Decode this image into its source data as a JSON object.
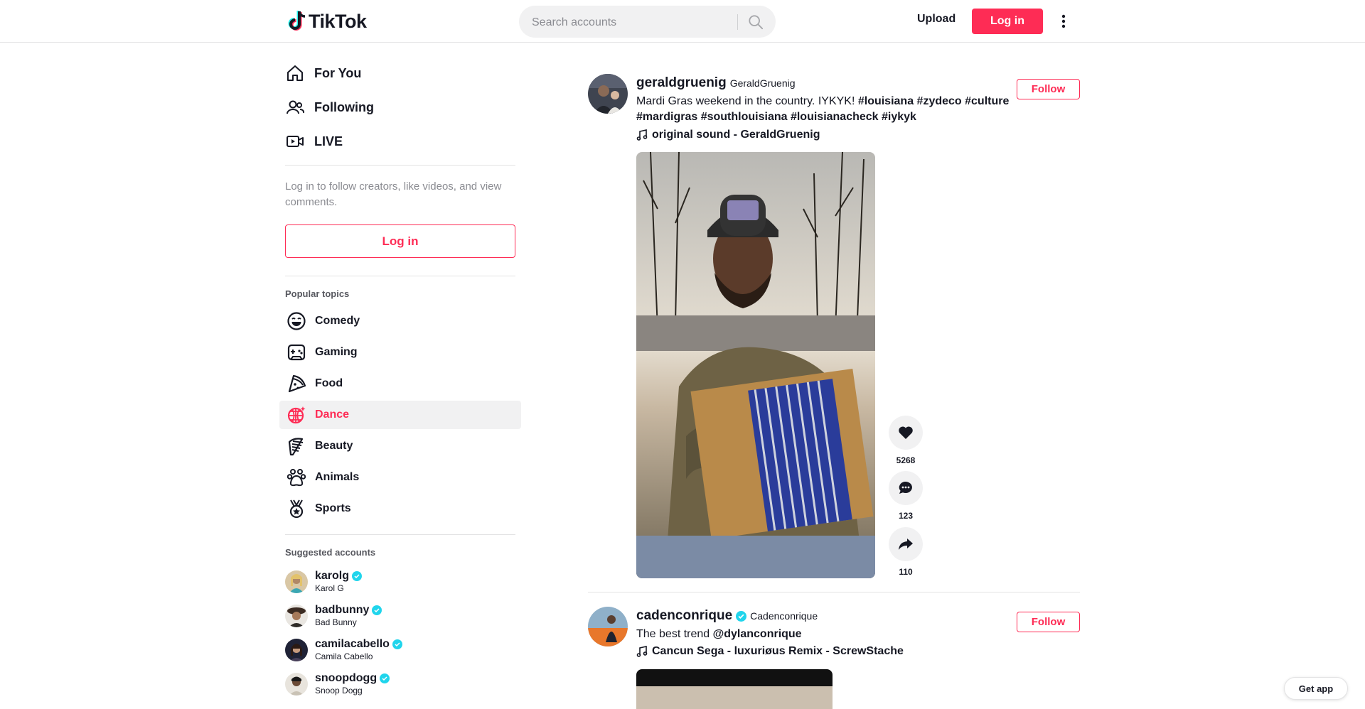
{
  "header": {
    "logo_text": "TikTok",
    "search_placeholder": "Search accounts",
    "upload_label": "Upload",
    "login_label": "Log in"
  },
  "sidebar": {
    "nav": [
      {
        "label": "For You",
        "icon": "home-icon"
      },
      {
        "label": "Following",
        "icon": "people-icon"
      },
      {
        "label": "LIVE",
        "icon": "live-icon"
      }
    ],
    "login_hint": "Log in to follow creators, like videos, and view comments.",
    "login_button": "Log in",
    "popular_title": "Popular topics",
    "topics": [
      {
        "label": "Comedy",
        "icon": "smile-icon"
      },
      {
        "label": "Gaming",
        "icon": "gamepad-icon"
      },
      {
        "label": "Food",
        "icon": "pizza-icon"
      },
      {
        "label": "Dance",
        "icon": "disco-icon",
        "active": true
      },
      {
        "label": "Beauty",
        "icon": "comb-icon"
      },
      {
        "label": "Animals",
        "icon": "paw-icon"
      },
      {
        "label": "Sports",
        "icon": "medal-icon"
      }
    ],
    "suggested_title": "Suggested accounts",
    "accounts": [
      {
        "username": "karolg",
        "name": "Karol G"
      },
      {
        "username": "badbunny",
        "name": "Bad Bunny"
      },
      {
        "username": "camilacabello",
        "name": "Camila Cabello"
      },
      {
        "username": "snoopdogg",
        "name": "Snoop Dogg"
      }
    ]
  },
  "feed": {
    "posts": [
      {
        "username": "geraldgruenig",
        "nickname": "GeraldGruenig",
        "desc_text": "Mardi Gras weekend in the country. IYKYK! ",
        "tags_line1": "#louisiana #zydeco #culture",
        "tags_line2": "#mardigras #southlouisiana #louisianacheck #iykyk",
        "music": "original sound - GeraldGruenig",
        "follow_label": "Follow",
        "likes": "5268",
        "comments": "123",
        "shares": "110"
      },
      {
        "username": "cadenconrique",
        "nickname": "Cadenconrique",
        "desc_text": "The best trend ",
        "mention": "@dylanconrique",
        "music": "Cancun Sega - luxuriøus Remix - ScrewStache",
        "follow_label": "Follow"
      }
    ]
  },
  "get_app_label": "Get app",
  "colors": {
    "brand": "#fe2c55",
    "verified": "#20d5ec",
    "text": "#161823",
    "muted": "#8a8b91"
  }
}
